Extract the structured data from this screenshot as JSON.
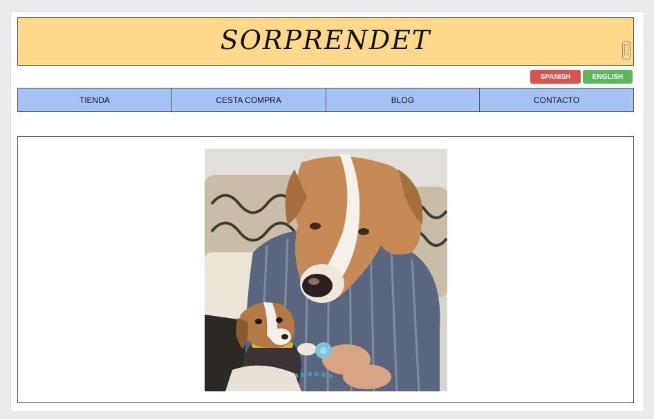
{
  "header": {
    "brand": "SORPRENDET",
    "phone_icon": "mobile-phone-icon"
  },
  "languages": {
    "spanish": "SPANISH",
    "english": "ENGLISH",
    "colors": {
      "spanish": "#d9534f",
      "english": "#5cb85c"
    }
  },
  "nav": {
    "items": [
      {
        "label": "TIENDA"
      },
      {
        "label": "CESTA COMPRA"
      },
      {
        "label": "BLOG"
      },
      {
        "label": "CONTACTO"
      }
    ]
  },
  "colors": {
    "banner": "#ffd98a",
    "nav": "#a4c2f4"
  }
}
